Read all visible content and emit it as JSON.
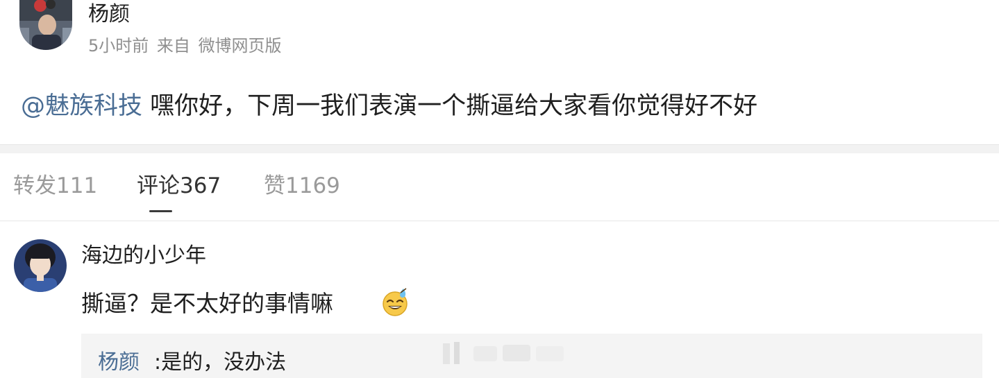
{
  "post": {
    "author": "杨颜",
    "meta": {
      "time": "5小时前",
      "source_prefix": "来自",
      "source": "微博网页版"
    },
    "mention": "@魅族科技",
    "text": " 嘿你好，下周一我们表演一个撕逼给大家看你觉得好不好"
  },
  "tabs": [
    {
      "label": "转发111",
      "active": false
    },
    {
      "label": "评论367",
      "active": true
    },
    {
      "label": "赞1169",
      "active": false
    }
  ],
  "comment": {
    "author": "海边的小少年",
    "text": "撕逼？是不太好的事情嘛",
    "emoji": "grinning-sweat-emoji",
    "reply": {
      "author": "杨颜",
      "text": ":是的，没办法"
    }
  },
  "colors": {
    "link": "#4a6d94",
    "meta": "#8f8f8f",
    "tab_inactive": "#9a9a9a",
    "tab_active": "#333333",
    "band": "#f2f2f2",
    "reply_bg": "#f4f4f4"
  }
}
